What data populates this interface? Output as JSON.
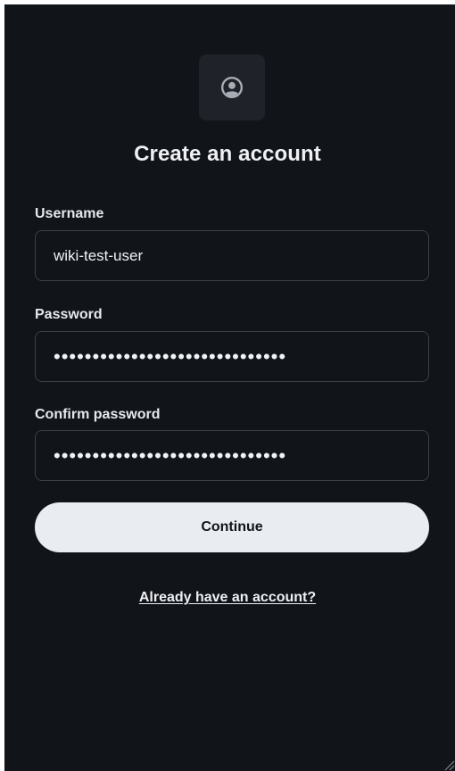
{
  "page": {
    "title": "Create an account"
  },
  "icons": {
    "logo": "user-circle-icon",
    "resize": "resize-grip-icon"
  },
  "form": {
    "username": {
      "label": "Username",
      "value": "wiki-test-user"
    },
    "password": {
      "label": "Password",
      "value": "••••••••••••••••••••••••••••••"
    },
    "confirm_password": {
      "label": "Confirm password",
      "value": "••••••••••••••••••••••••••••••"
    },
    "continue_label": "Continue",
    "signin_link": "Already have an account?"
  },
  "colors": {
    "background": "#111418",
    "field_border": "#3b4049",
    "button_background": "#e9ecf1",
    "text": "#eef0f4"
  }
}
